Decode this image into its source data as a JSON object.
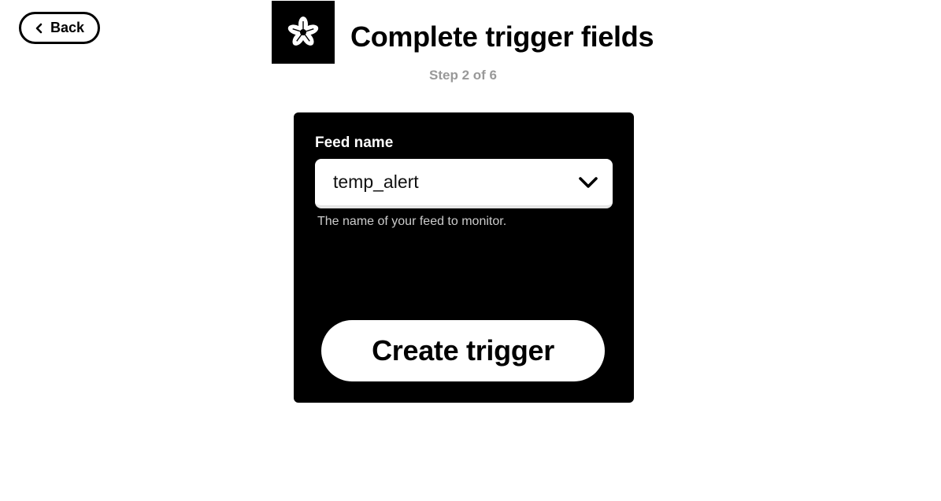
{
  "header": {
    "back_label": "Back",
    "title": "Complete trigger fields",
    "step": "Step 2 of 6",
    "logo_icon": "adafruit-flower-icon"
  },
  "form": {
    "field_label": "Feed name",
    "selected_value": "temp_alert",
    "helper_text": "The name of your feed to monitor.",
    "submit_label": "Create trigger"
  },
  "colors": {
    "card_background": "#000000",
    "step_text": "#999999",
    "helper_text": "#cccccc"
  }
}
